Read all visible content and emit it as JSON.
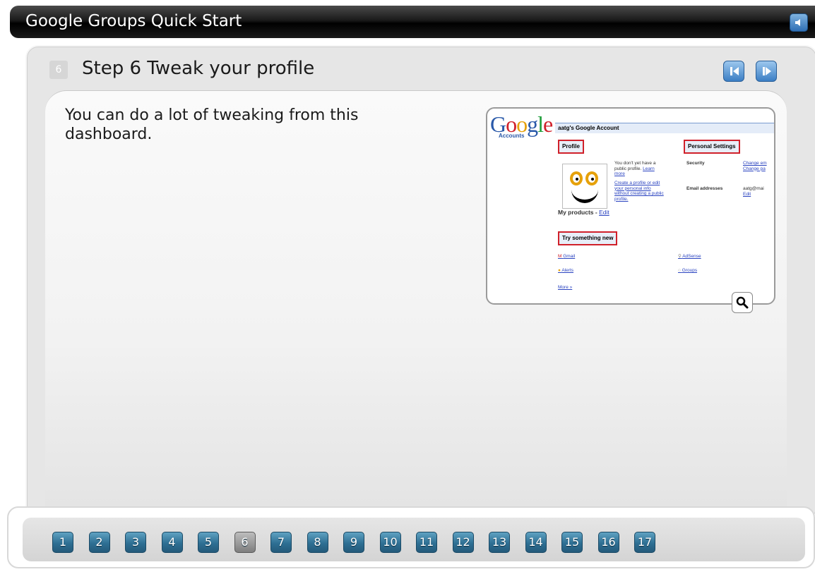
{
  "app": {
    "title": "Google Groups Quick Start"
  },
  "step": {
    "number": "6",
    "title": "Step 6 Tweak your profile",
    "body": "You can do a lot of tweaking from this dashboard."
  },
  "screenshot": {
    "logo": "Google",
    "logo_sub": "Accounts",
    "account_title": "aatg's Google Account",
    "profile_label": "Profile",
    "personal_settings_label": "Personal Settings",
    "no_profile_text": "You don't yet have a public profile.",
    "learn_more": "Learn more",
    "create_profile_text": "Create a profile or edit your personal info without creating a public profile.",
    "security_label": "Security",
    "change_links": "Change em Change pa",
    "email_label": "Email addresses",
    "email_value": "aatg@mai",
    "edit_label": "Edit",
    "my_products": "My products -",
    "try_something_new": "Try something new",
    "products": [
      "Gmail",
      "AdSense",
      "Alerts",
      "Groups"
    ],
    "more": "More »"
  },
  "pages": [
    "1",
    "2",
    "3",
    "4",
    "5",
    "6",
    "7",
    "8",
    "9",
    "10",
    "11",
    "12",
    "13",
    "14",
    "15",
    "16",
    "17"
  ],
  "current_page": "6"
}
